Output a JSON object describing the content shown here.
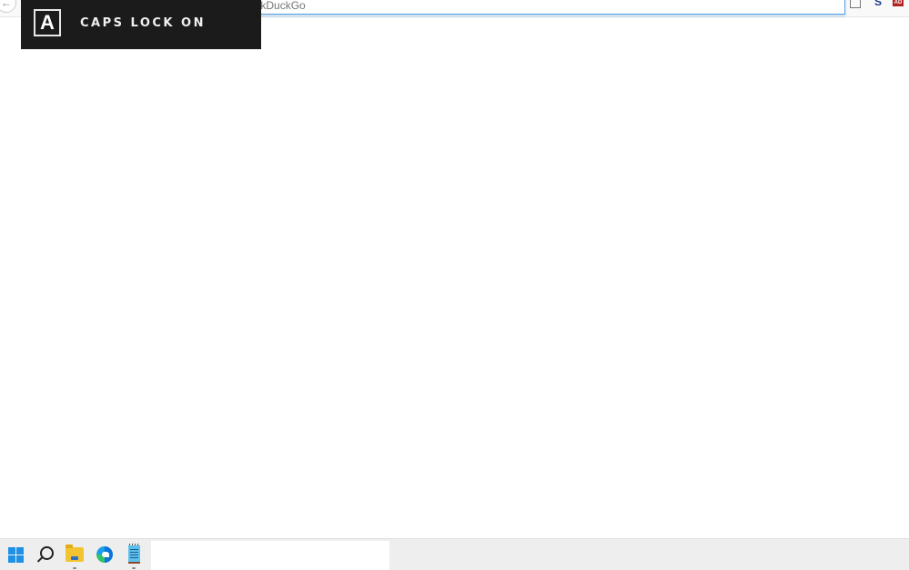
{
  "browser": {
    "search_placeholder": "Search with DuckDuckGo",
    "back_icon": "arrow-left-icon",
    "extensions": [
      {
        "name": "reader-view",
        "glyph": "▯"
      },
      {
        "name": "s-extension",
        "glyph": "S"
      },
      {
        "name": "red-extension",
        "glyph": "AD"
      }
    ]
  },
  "osd": {
    "key_glyph": "A",
    "label": "CAPS LOCK ON"
  },
  "taskbar": {
    "icons": [
      {
        "name": "start",
        "running": false
      },
      {
        "name": "search",
        "running": false
      },
      {
        "name": "file-explorer",
        "running": true
      },
      {
        "name": "edge",
        "running": false
      },
      {
        "name": "notepad",
        "running": true
      }
    ]
  }
}
